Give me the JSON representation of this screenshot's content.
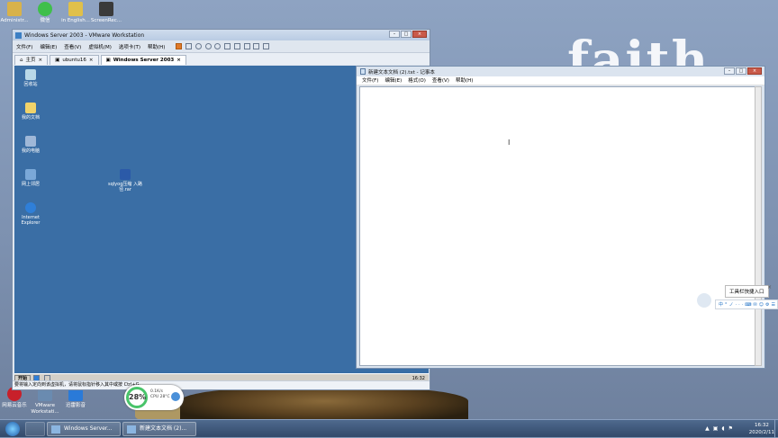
{
  "desktop": {
    "top_icons": [
      {
        "label": "Administr...",
        "color": "#d8b24a"
      },
      {
        "label": "微信",
        "color": "#3fbf4b"
      },
      {
        "label": "in English...",
        "color": "#e0c04a"
      },
      {
        "label": "ScreenRec...",
        "color": "#3a3a3a"
      }
    ],
    "bottom_icons": [
      {
        "label": "网易云音乐",
        "color": "#c8202a"
      },
      {
        "label": "VMware Workstati...",
        "color": "#6a8bb0"
      },
      {
        "label": "迅雷影音",
        "color": "#2a7ad8"
      }
    ],
    "wallpaper_text": "faith"
  },
  "vmware": {
    "title": "Windows Server 2003 - VMware Workstation",
    "menu": [
      "文件(F)",
      "编辑(E)",
      "查看(V)",
      "虚拟机(M)",
      "选项卡(T)",
      "帮助(H)"
    ],
    "tabs": [
      {
        "label": "主页"
      },
      {
        "label": "ubuntu16"
      },
      {
        "label": "Windows Server 2003"
      }
    ],
    "guest_icons": [
      {
        "label": "回收站",
        "color": "#b8d8e8"
      },
      {
        "label": "我的文档",
        "color": "#f1d36a"
      },
      {
        "label": "我的电脑",
        "color": "#9fb8d8"
      },
      {
        "label": "网上邻居",
        "color": "#7aa8d8"
      },
      {
        "label": "Internet Explorer",
        "color": "#2f7fd8"
      }
    ],
    "guest_file": {
      "label": "sqlyog压缩 入路径.rar",
      "color": "#2b5aa8"
    },
    "guest_start": "开始",
    "guest_clock": "16:32",
    "status": "要将输入定向到该虚拟机，请将鼠标指针移入其中或按 Ctrl+G。"
  },
  "notepad": {
    "title": "新建文本文档 (2).txt - 记事本",
    "menu": [
      "文件(F)",
      "编辑(E)",
      "格式(O)",
      "查看(V)",
      "帮助(H)"
    ],
    "content": ""
  },
  "widget": {
    "cpu_percent": "28%",
    "net_speed": "0.1K/s",
    "cpu_temp": "CPU 28°C"
  },
  "toolbar_tooltip": "工具栏快捷入口",
  "ime_items": [
    "中",
    "°",
    "ノ",
    "·",
    "·",
    "·",
    "⌨",
    "✉",
    "☺",
    "⚙",
    "☰"
  ],
  "taskbar": {
    "tasks": [
      {
        "label": "Windows Server..."
      },
      {
        "label": "新建文本文档 (2)..."
      }
    ],
    "time": "16:32",
    "date": "2020/2/11"
  }
}
